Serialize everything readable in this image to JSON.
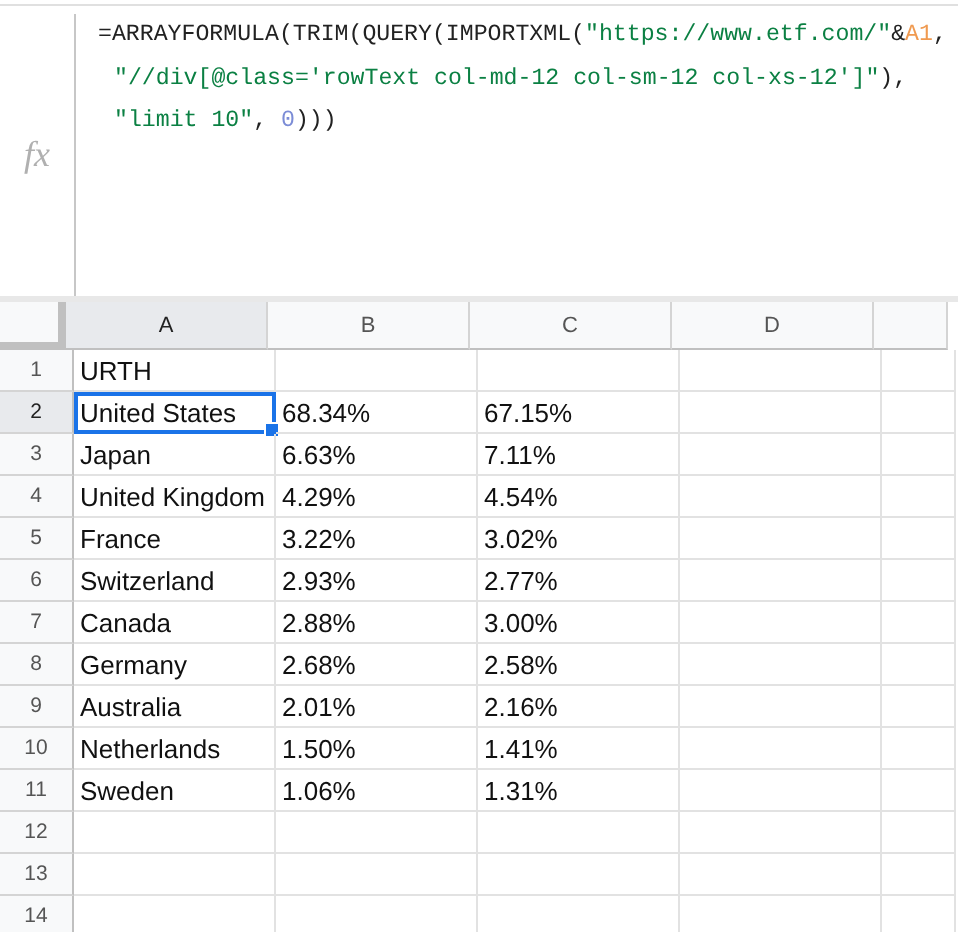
{
  "formula_bar": {
    "label": "fx",
    "lines": [
      [
        {
          "kind": "plain",
          "text": "=ARRAYFORMULA(TRIM(QUERY(IMPORTXML("
        },
        {
          "kind": "string",
          "text": "\"https://www.etf.com/\""
        },
        {
          "kind": "plain",
          "text": "&"
        },
        {
          "kind": "ref",
          "text": "A1"
        },
        {
          "kind": "plain",
          "text": ","
        }
      ],
      [
        {
          "kind": "string",
          "text": "\"//div[@class='rowText col-md-12 col-sm-12 col-xs-12']\""
        },
        {
          "kind": "plain",
          "text": "),"
        }
      ],
      [
        {
          "kind": "string",
          "text": "\"limit 10\""
        },
        {
          "kind": "plain",
          "text": ", "
        },
        {
          "kind": "number",
          "text": "0"
        },
        {
          "kind": "plain",
          "text": ")))"
        }
      ]
    ]
  },
  "sheet": {
    "columns": [
      {
        "label": "A",
        "selected": true
      },
      {
        "label": "B",
        "selected": false
      },
      {
        "label": "C",
        "selected": false
      },
      {
        "label": "D",
        "selected": false
      }
    ],
    "rows": [
      {
        "number": "1",
        "selected": false,
        "cells": [
          {
            "text": "URTH",
            "selected": false
          }
        ]
      },
      {
        "number": "2",
        "selected": true,
        "cells": [
          {
            "text": "United States",
            "selected": true
          },
          {
            "text": "68.34%",
            "selected": false
          },
          {
            "text": "67.15%",
            "selected": false
          }
        ]
      },
      {
        "number": "3",
        "selected": false,
        "cells": [
          {
            "text": "Japan",
            "selected": false
          },
          {
            "text": "6.63%",
            "selected": false
          },
          {
            "text": "7.11%",
            "selected": false
          }
        ]
      },
      {
        "number": "4",
        "selected": false,
        "cells": [
          {
            "text": "United Kingdom",
            "selected": false
          },
          {
            "text": "4.29%",
            "selected": false
          },
          {
            "text": "4.54%",
            "selected": false
          }
        ]
      },
      {
        "number": "5",
        "selected": false,
        "cells": [
          {
            "text": "France",
            "selected": false
          },
          {
            "text": "3.22%",
            "selected": false
          },
          {
            "text": "3.02%",
            "selected": false
          }
        ]
      },
      {
        "number": "6",
        "selected": false,
        "cells": [
          {
            "text": "Switzerland",
            "selected": false
          },
          {
            "text": "2.93%",
            "selected": false
          },
          {
            "text": "2.77%",
            "selected": false
          }
        ]
      },
      {
        "number": "7",
        "selected": false,
        "cells": [
          {
            "text": "Canada",
            "selected": false
          },
          {
            "text": "2.88%",
            "selected": false
          },
          {
            "text": "3.00%",
            "selected": false
          }
        ]
      },
      {
        "number": "8",
        "selected": false,
        "cells": [
          {
            "text": "Germany",
            "selected": false
          },
          {
            "text": "2.68%",
            "selected": false
          },
          {
            "text": "2.58%",
            "selected": false
          }
        ]
      },
      {
        "number": "9",
        "selected": false,
        "cells": [
          {
            "text": "Australia",
            "selected": false
          },
          {
            "text": "2.01%",
            "selected": false
          },
          {
            "text": "2.16%",
            "selected": false
          }
        ]
      },
      {
        "number": "10",
        "selected": false,
        "cells": [
          {
            "text": "Netherlands",
            "selected": false
          },
          {
            "text": "1.50%",
            "selected": false
          },
          {
            "text": "1.41%",
            "selected": false
          }
        ]
      },
      {
        "number": "11",
        "selected": false,
        "cells": [
          {
            "text": "Sweden",
            "selected": false
          },
          {
            "text": "1.06%",
            "selected": false
          },
          {
            "text": "1.31%",
            "selected": false
          }
        ]
      },
      {
        "number": "12",
        "selected": false
      },
      {
        "number": "13",
        "selected": false
      },
      {
        "number": "14",
        "selected": false
      }
    ]
  }
}
